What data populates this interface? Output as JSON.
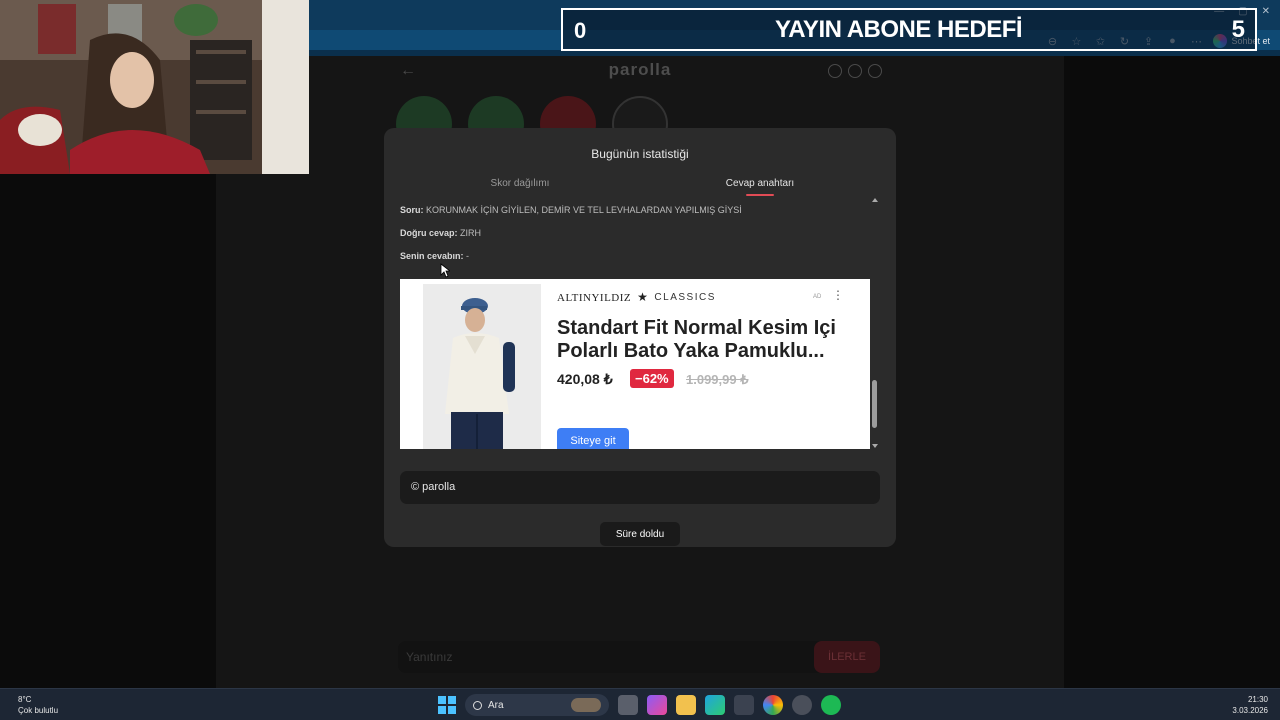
{
  "browser": {
    "chat_label": "Sohbet et"
  },
  "game": {
    "title": "parolla",
    "answer_placeholder": "Yanıtınız",
    "submit_label": "İLERLE"
  },
  "modal": {
    "title": "Bugünün istatistiği",
    "tabs": [
      {
        "label": "Skor dağılımı",
        "active": false
      },
      {
        "label": "Cevap anahtarı",
        "active": true
      }
    ],
    "question_label": "Soru:",
    "question_text": "KORUNMAK İÇİN GİYİLEN, DEMİR VE TEL LEVHALARDAN YAPILMIŞ GİYSİ",
    "correct_label": "Doğru cevap:",
    "correct_text": "ZIRH",
    "yours_label": "Senin cevabın:",
    "yours_text": "-",
    "credit": "© parolla",
    "time_button": "Süre doldu"
  },
  "ad": {
    "brand": "ALTINYILDIZ",
    "brand_sub": "CLASSICS",
    "ad_marker": "AD",
    "title": "Standart Fit Normal Kesim Içi Polarlı Bato Yaka Pamuklu...",
    "price": "420,08 ₺",
    "discount": "−62%",
    "old_price": "1.099,99 ₺",
    "cta": "Siteye git"
  },
  "overlay": {
    "goal_left": "0",
    "goal_title": "YAYIN ABONE HEDEFİ",
    "goal_right": "5"
  },
  "taskbar": {
    "temperature": "8°C",
    "weather": "Çok bulutlu",
    "search_label": "Ara",
    "time": "21:30",
    "date": "3.03.2026"
  },
  "colors": {
    "accent_underline": "#e14b55",
    "discount_badge": "#e0283f",
    "cta_button": "#3e7ef5",
    "modal_bg": "#2b2b2b"
  }
}
